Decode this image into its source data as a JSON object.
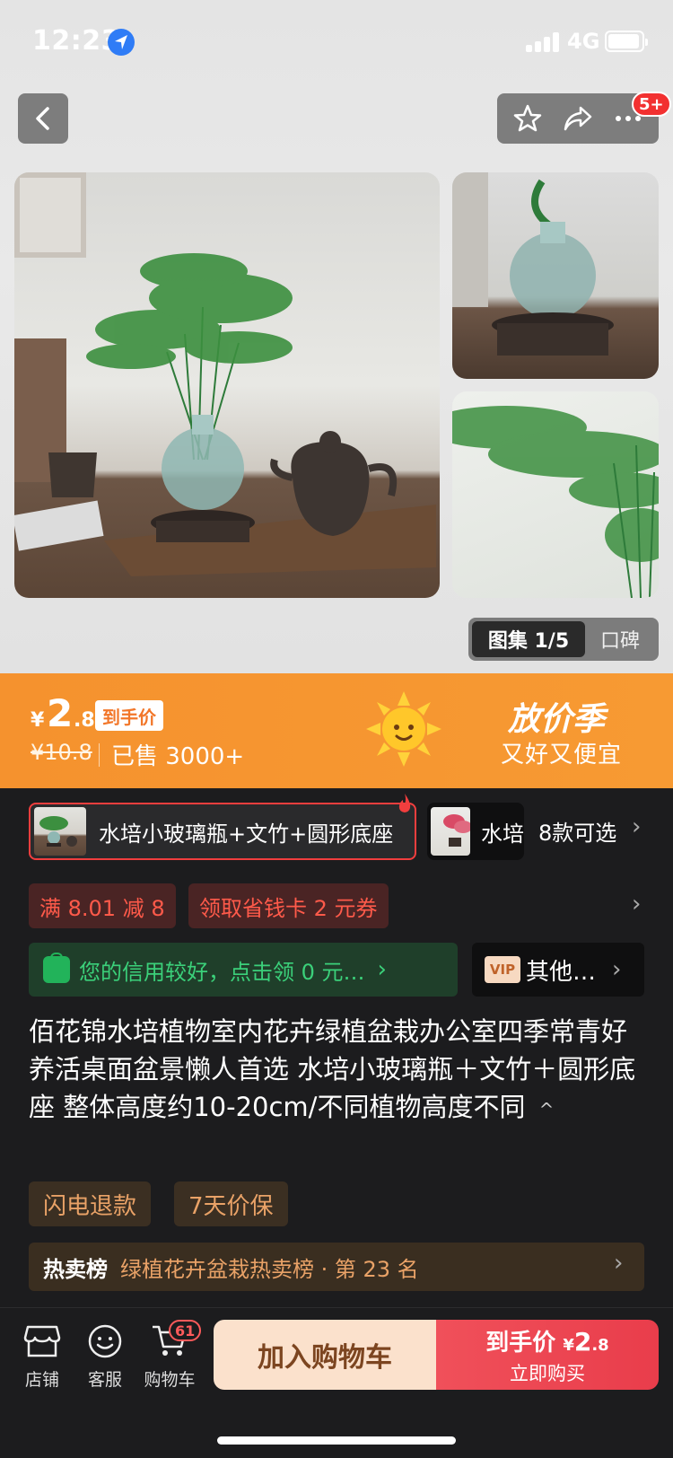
{
  "status_bar": {
    "time": "12:23",
    "network": "4G"
  },
  "header": {
    "message_badge": "5+"
  },
  "gallery": {
    "active_tab": "图集 1/5",
    "other_tab": "口碑"
  },
  "price": {
    "currency": "¥",
    "value": "2",
    "cents": ".8",
    "tag": "到手价",
    "original": "¥10.8",
    "sold": "已售 3000+",
    "promo_title": "放价季",
    "promo_subtitle": "又好又便宜"
  },
  "variants": {
    "selected_label": "水培小玻璃瓶+文竹+圆形底座",
    "other_label": "水培",
    "count_label": "8款可选"
  },
  "coupons": [
    "满 8.01 减 8",
    "领取省钱卡 2 元券"
  ],
  "credit": {
    "text": "您的信用较好，点击领 0 元…",
    "vip_badge": "VIP",
    "vip_text": "其他…"
  },
  "product": {
    "title": "佰花锦水培植物室内花卉绿植盆栽办公室四季常青好养活桌面盆景懒人首选 水培小玻璃瓶＋文竹＋圆形底座 整体高度约10-20cm/不同植物高度不同",
    "collapse": "^"
  },
  "services": [
    "闪电退款",
    "7天价保"
  ],
  "rank": {
    "label": "热卖榜",
    "text": "绿植花卉盆栽热卖榜 · 第 23 名"
  },
  "bottom_nav": {
    "shop": "店铺",
    "service": "客服",
    "cart": "购物车",
    "cart_badge": "61"
  },
  "actions": {
    "add_to_cart": "加入购物车",
    "buy_price_label": "到手价",
    "buy_currency": "¥",
    "buy_price_int": "2",
    "buy_price_dec": ".8",
    "buy_now": "立即购买"
  },
  "colors": {
    "accent_orange": "#f5922e",
    "buy_red": "#e93d4b",
    "coupon_red": "#ff5a4a",
    "credit_green": "#3bd07a"
  }
}
